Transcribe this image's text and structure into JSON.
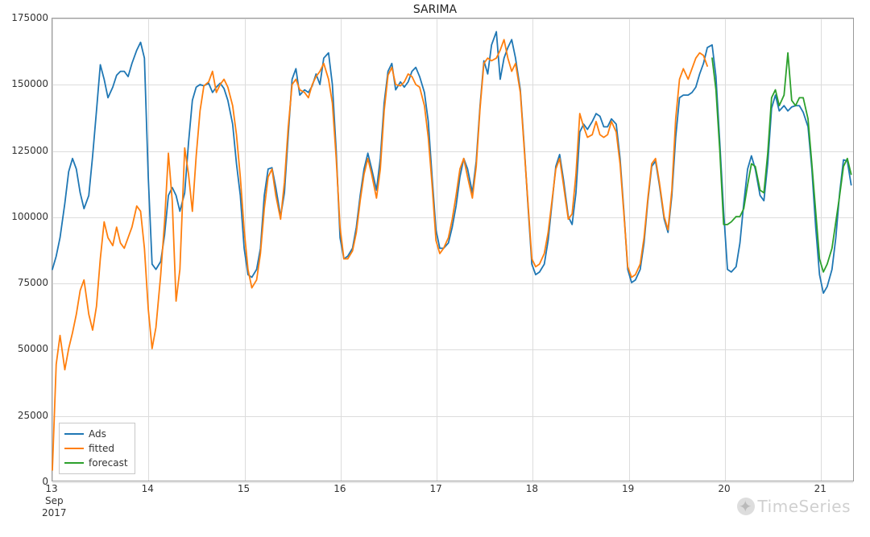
{
  "chart_data": {
    "type": "line",
    "title": "SARIMA",
    "xlabel": "",
    "ylabel": "",
    "ylim": [
      0,
      175000
    ],
    "yticks": [
      0,
      25000,
      50000,
      75000,
      100000,
      125000,
      150000,
      175000
    ],
    "xrange": [
      13.0,
      21.35
    ],
    "xticks": [
      13,
      14,
      15,
      16,
      17,
      18,
      19,
      20,
      21
    ],
    "xtick_labels": [
      "13",
      "14",
      "15",
      "16",
      "17",
      "18",
      "19",
      "20",
      "21"
    ],
    "x_axis_sub_labels": {
      "month": "Sep",
      "year": "2017"
    },
    "legend_position": "lower-left",
    "grid": true,
    "colors": {
      "Ads": "#1f77b4",
      "fitted": "#ff7f0e",
      "forecast": "#2ca02c"
    },
    "series": [
      {
        "name": "Ads",
        "x": [
          13.0,
          13.04,
          13.08,
          13.13,
          13.17,
          13.21,
          13.25,
          13.29,
          13.33,
          13.38,
          13.42,
          13.46,
          13.5,
          13.54,
          13.58,
          13.63,
          13.67,
          13.71,
          13.75,
          13.79,
          13.83,
          13.88,
          13.92,
          13.96,
          14.0,
          14.04,
          14.08,
          14.13,
          14.17,
          14.21,
          14.25,
          14.29,
          14.33,
          14.38,
          14.42,
          14.46,
          14.5,
          14.54,
          14.58,
          14.63,
          14.67,
          14.71,
          14.75,
          14.79,
          14.83,
          14.88,
          14.92,
          14.96,
          15.0,
          15.04,
          15.08,
          15.13,
          15.17,
          15.21,
          15.25,
          15.29,
          15.33,
          15.38,
          15.42,
          15.46,
          15.5,
          15.54,
          15.58,
          15.63,
          15.67,
          15.71,
          15.75,
          15.79,
          15.83,
          15.88,
          15.92,
          15.96,
          16.0,
          16.04,
          16.08,
          16.13,
          16.17,
          16.21,
          16.25,
          16.29,
          16.33,
          16.38,
          16.42,
          16.46,
          16.5,
          16.54,
          16.58,
          16.63,
          16.67,
          16.71,
          16.75,
          16.79,
          16.83,
          16.88,
          16.92,
          16.96,
          17.0,
          17.04,
          17.08,
          17.13,
          17.17,
          17.21,
          17.25,
          17.29,
          17.33,
          17.38,
          17.42,
          17.46,
          17.5,
          17.54,
          17.58,
          17.63,
          17.67,
          17.71,
          17.75,
          17.79,
          17.83,
          17.88,
          17.92,
          17.96,
          18.0,
          18.04,
          18.08,
          18.13,
          18.17,
          18.21,
          18.25,
          18.29,
          18.33,
          18.38,
          18.42,
          18.46,
          18.5,
          18.54,
          18.58,
          18.63,
          18.67,
          18.71,
          18.75,
          18.79,
          18.83,
          18.88,
          18.92,
          18.96,
          19.0,
          19.04,
          19.08,
          19.13,
          19.17,
          19.21,
          19.25,
          19.29,
          19.33,
          19.38,
          19.42,
          19.46,
          19.5,
          19.54,
          19.58,
          19.63,
          19.67,
          19.71,
          19.75,
          19.79,
          19.83,
          19.88,
          19.92,
          19.96,
          20.0,
          20.04,
          20.08,
          20.13,
          20.17,
          20.21,
          20.25,
          20.29,
          20.33,
          20.38,
          20.42,
          20.46,
          20.5,
          20.54,
          20.58,
          20.63,
          20.67,
          20.71,
          20.75,
          20.79,
          20.83,
          20.88,
          20.92,
          20.96,
          21.0,
          21.04,
          21.08,
          21.13,
          21.17,
          21.21,
          21.25,
          21.29,
          21.33
        ],
        "y": [
          80000,
          85000,
          92000,
          105000,
          117000,
          122000,
          118000,
          109000,
          103000,
          108000,
          123000,
          140000,
          157500,
          152000,
          145000,
          149000,
          153500,
          155000,
          155000,
          153000,
          158000,
          163000,
          166000,
          160000,
          115000,
          82000,
          80000,
          83000,
          93000,
          108000,
          111000,
          108000,
          102000,
          109000,
          128000,
          144000,
          149000,
          150000,
          149500,
          150500,
          147000,
          149000,
          150500,
          148500,
          144000,
          135000,
          120000,
          108000,
          88000,
          78000,
          77000,
          80000,
          88000,
          108000,
          118000,
          118500,
          111000,
          100000,
          109000,
          131000,
          152000,
          156000,
          146000,
          148000,
          147000,
          149500,
          154000,
          150000,
          160000,
          162000,
          150000,
          125000,
          92000,
          84000,
          85000,
          88000,
          96000,
          108000,
          118000,
          124000,
          118000,
          110000,
          122000,
          143000,
          155000,
          158000,
          148000,
          151000,
          149000,
          151000,
          155000,
          156500,
          153000,
          147000,
          136000,
          115000,
          95000,
          88000,
          88000,
          90000,
          96000,
          104000,
          115000,
          122000,
          118000,
          109000,
          121000,
          142000,
          159000,
          154000,
          165000,
          170000,
          152000,
          160000,
          164000,
          167000,
          160000,
          148000,
          127000,
          104000,
          82000,
          78000,
          79000,
          82000,
          91000,
          105000,
          119000,
          123500,
          114000,
          100000,
          97000,
          109000,
          132000,
          135000,
          133000,
          136000,
          139000,
          138000,
          134000,
          134000,
          137000,
          135000,
          122000,
          102000,
          80000,
          75000,
          76000,
          80000,
          90000,
          106000,
          119000,
          121000,
          112000,
          99000,
          94000,
          108000,
          130000,
          145000,
          146000,
          146000,
          147000,
          149000,
          154000,
          158000,
          164000,
          165000,
          153000,
          128000,
          102000,
          80000,
          79000,
          81000,
          90000,
          105000,
          118000,
          123000,
          118000,
          108000,
          106000,
          120000,
          141000,
          146000,
          140000,
          142000,
          140000,
          141500,
          142000,
          142000,
          139500,
          134000,
          118000,
          96000,
          78000,
          71000,
          73500,
          80000,
          92000,
          109000,
          121500,
          121000,
          112000
        ]
      },
      {
        "name": "fitted",
        "x": [
          13.0,
          13.04,
          13.08,
          13.13,
          13.17,
          13.21,
          13.25,
          13.29,
          13.33,
          13.38,
          13.42,
          13.46,
          13.5,
          13.54,
          13.58,
          13.63,
          13.67,
          13.71,
          13.75,
          13.79,
          13.83,
          13.88,
          13.92,
          13.96,
          14.0,
          14.04,
          14.08,
          14.13,
          14.17,
          14.21,
          14.25,
          14.29,
          14.33,
          14.38,
          14.42,
          14.46,
          14.5,
          14.54,
          14.58,
          14.63,
          14.67,
          14.71,
          14.75,
          14.79,
          14.83,
          14.88,
          14.92,
          14.96,
          15.0,
          15.04,
          15.08,
          15.13,
          15.17,
          15.21,
          15.25,
          15.29,
          15.33,
          15.38,
          15.42,
          15.46,
          15.5,
          15.54,
          15.58,
          15.63,
          15.67,
          15.71,
          15.75,
          15.79,
          15.83,
          15.88,
          15.92,
          15.96,
          16.0,
          16.04,
          16.08,
          16.13,
          16.17,
          16.21,
          16.25,
          16.29,
          16.33,
          16.38,
          16.42,
          16.46,
          16.5,
          16.54,
          16.58,
          16.63,
          16.67,
          16.71,
          16.75,
          16.79,
          16.83,
          16.88,
          16.92,
          16.96,
          17.0,
          17.04,
          17.08,
          17.13,
          17.17,
          17.21,
          17.25,
          17.29,
          17.33,
          17.38,
          17.42,
          17.46,
          17.5,
          17.54,
          17.58,
          17.63,
          17.67,
          17.71,
          17.75,
          17.79,
          17.83,
          17.88,
          17.92,
          17.96,
          18.0,
          18.04,
          18.08,
          18.13,
          18.17,
          18.21,
          18.25,
          18.29,
          18.33,
          18.38,
          18.42,
          18.46,
          18.5,
          18.54,
          18.58,
          18.63,
          18.67,
          18.71,
          18.75,
          18.79,
          18.83,
          18.88,
          18.92,
          18.96,
          19.0,
          19.04,
          19.08,
          19.13,
          19.17,
          19.21,
          19.25,
          19.29,
          19.33,
          19.38,
          19.42,
          19.46,
          19.5,
          19.54,
          19.58,
          19.63,
          19.67,
          19.71,
          19.75,
          19.79,
          19.83
        ],
        "y": [
          4000,
          44000,
          55000,
          42000,
          50000,
          56000,
          63000,
          72000,
          76000,
          63000,
          57000,
          66000,
          84000,
          98000,
          92000,
          89000,
          96000,
          90000,
          88000,
          92000,
          96000,
          104000,
          102000,
          88000,
          65000,
          50000,
          58000,
          78000,
          98000,
          124000,
          106000,
          68000,
          80000,
          126000,
          116000,
          102000,
          123000,
          140000,
          149500,
          151000,
          155000,
          147000,
          150000,
          152000,
          149000,
          142000,
          131000,
          115000,
          95000,
          80000,
          73000,
          76000,
          86000,
          103000,
          115000,
          118000,
          108000,
          99000,
          113000,
          134000,
          150000,
          152000,
          148000,
          147000,
          145000,
          150000,
          153000,
          155000,
          158000,
          152000,
          143000,
          122000,
          96000,
          84000,
          84000,
          87000,
          94000,
          106000,
          116000,
          122000,
          116000,
          107000,
          118000,
          140000,
          153500,
          156500,
          150000,
          149500,
          151000,
          154000,
          153000,
          150000,
          149000,
          142000,
          130000,
          112000,
          91000,
          86000,
          88000,
          92000,
          99000,
          108000,
          118000,
          122000,
          115000,
          107000,
          119000,
          141000,
          158000,
          160000,
          159000,
          160000,
          163000,
          167000,
          160000,
          155000,
          158000,
          147000,
          126000,
          105000,
          84000,
          81000,
          82000,
          86000,
          94000,
          106000,
          118000,
          122000,
          112000,
          99000,
          101000,
          116000,
          139000,
          134000,
          130000,
          131000,
          136000,
          131000,
          130000,
          131000,
          136000,
          132000,
          120000,
          101000,
          81000,
          77000,
          78000,
          82000,
          92000,
          107000,
          120000,
          122000,
          113000,
          100000,
          95000,
          110000,
          137000,
          152000,
          156000,
          152000,
          156000,
          160000,
          162000,
          161000,
          157000
        ]
      },
      {
        "name": "forecast",
        "x": [
          19.88,
          19.92,
          19.96,
          20.0,
          20.04,
          20.08,
          20.13,
          20.17,
          20.21,
          20.25,
          20.29,
          20.33,
          20.38,
          20.42,
          20.46,
          20.5,
          20.54,
          20.58,
          20.63,
          20.67,
          20.71,
          20.75,
          20.79,
          20.83,
          20.88,
          20.92,
          20.96,
          21.0,
          21.04,
          21.08,
          21.13,
          21.17,
          21.21,
          21.25,
          21.29,
          21.33
        ],
        "y": [
          160000,
          148000,
          125000,
          97000,
          97000,
          98000,
          100000,
          100000,
          103000,
          112000,
          120000,
          119000,
          110000,
          109000,
          124000,
          145000,
          148000,
          142000,
          146000,
          162000,
          144000,
          142000,
          145000,
          145000,
          137000,
          120000,
          102000,
          84000,
          79000,
          82000,
          88000,
          98000,
          108000,
          119000,
          122000,
          116000
        ]
      }
    ],
    "legend_labels": [
      "Ads",
      "fitted",
      "forecast"
    ]
  },
  "watermark": {
    "text": "TimeSeries"
  }
}
